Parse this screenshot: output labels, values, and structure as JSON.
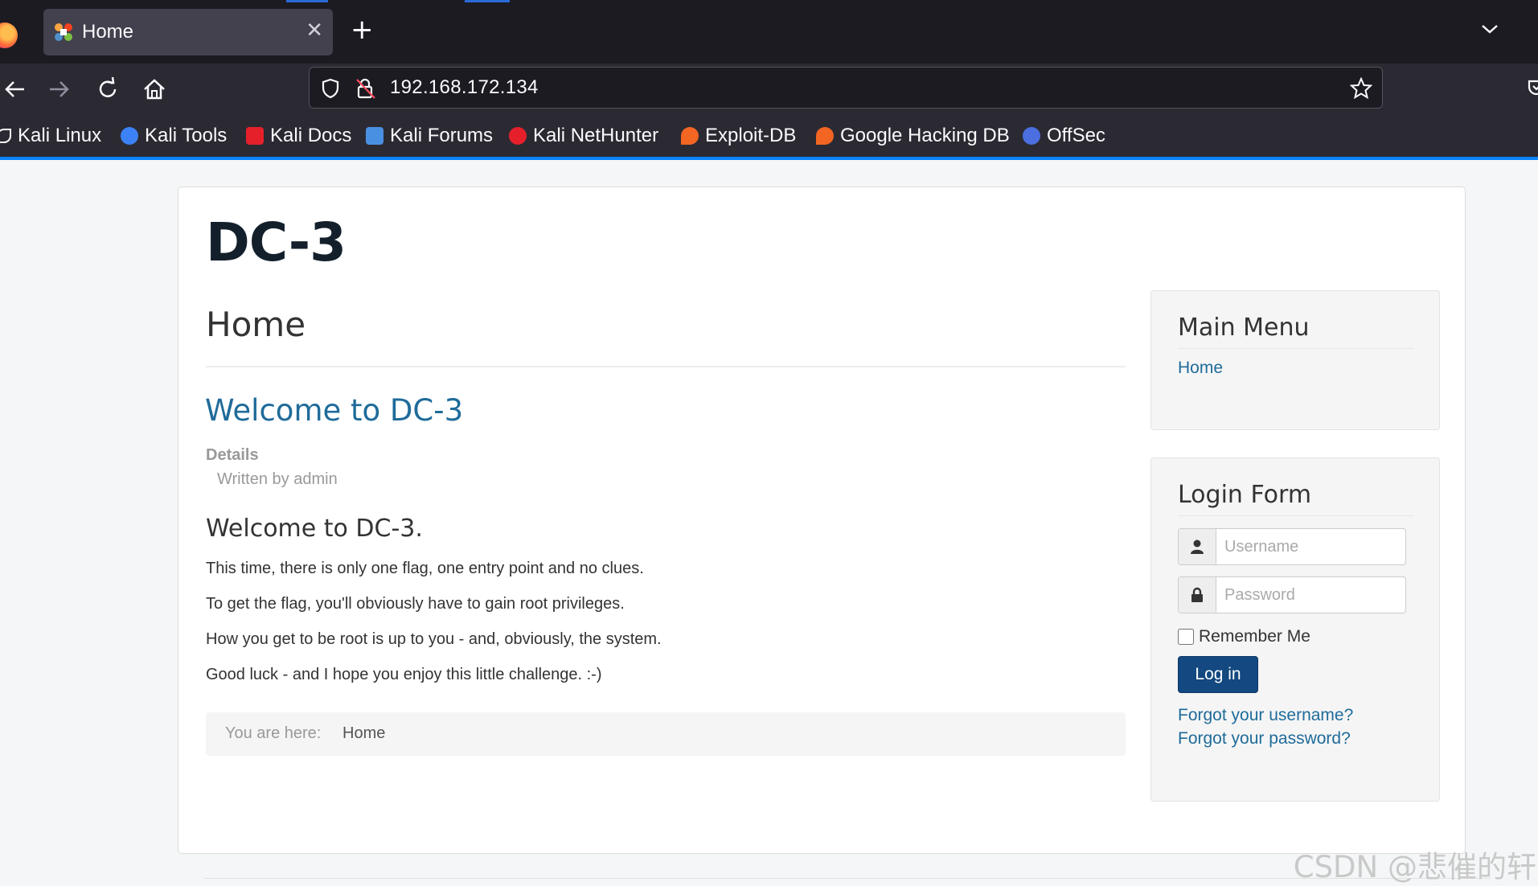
{
  "browser": {
    "tab": {
      "title": "Home"
    },
    "url": "192.168.172.134",
    "bookmarks": [
      {
        "label": "Kali Linux",
        "icon": "kali-dragon-icon",
        "color": "#ffffff"
      },
      {
        "label": "Kali Tools",
        "icon": "kali-tools-icon",
        "color": "#3c82f6"
      },
      {
        "label": "Kali Docs",
        "icon": "kali-docs-icon",
        "color": "#e5202b"
      },
      {
        "label": "Kali Forums",
        "icon": "kali-forums-icon",
        "color": "#4a90e2"
      },
      {
        "label": "Kali NetHunter",
        "icon": "kali-nethunter-icon",
        "color": "#e5202b"
      },
      {
        "label": "Exploit-DB",
        "icon": "exploit-db-icon",
        "color": "#f26522"
      },
      {
        "label": "Google Hacking DB",
        "icon": "ghdb-icon",
        "color": "#f26522"
      },
      {
        "label": "OffSec",
        "icon": "offsec-icon",
        "color": "#4b6fe0"
      }
    ]
  },
  "site": {
    "title": "DC-3"
  },
  "main": {
    "page_heading": "Home",
    "article": {
      "title": "Welcome to DC-3",
      "details_label": "Details",
      "written_by": "Written by admin",
      "subheading": "Welcome to DC-3.",
      "paragraphs": [
        "This time, there is only one flag, one entry point and no clues.",
        "To get the flag, you'll obviously have to gain root privileges.",
        "How you get to be root is up to you - and, obviously, the system.",
        "Good luck - and I hope you enjoy this little challenge.  :-)"
      ]
    },
    "breadcrumb": {
      "label": "You are here:",
      "current": "Home"
    }
  },
  "sidebar": {
    "main_menu": {
      "title": "Main Menu",
      "items": [
        "Home"
      ]
    },
    "login": {
      "title": "Login Form",
      "username_placeholder": "Username",
      "password_placeholder": "Password",
      "remember_label": "Remember Me",
      "button_label": "Log in",
      "forgot_username": "Forgot your username?",
      "forgot_password": "Forgot your password?"
    }
  },
  "watermark": "CSDN @悲催的轩",
  "colors": {
    "link": "#1f6b9a",
    "button": "#134880",
    "browser_accent": "#0a84ff"
  }
}
